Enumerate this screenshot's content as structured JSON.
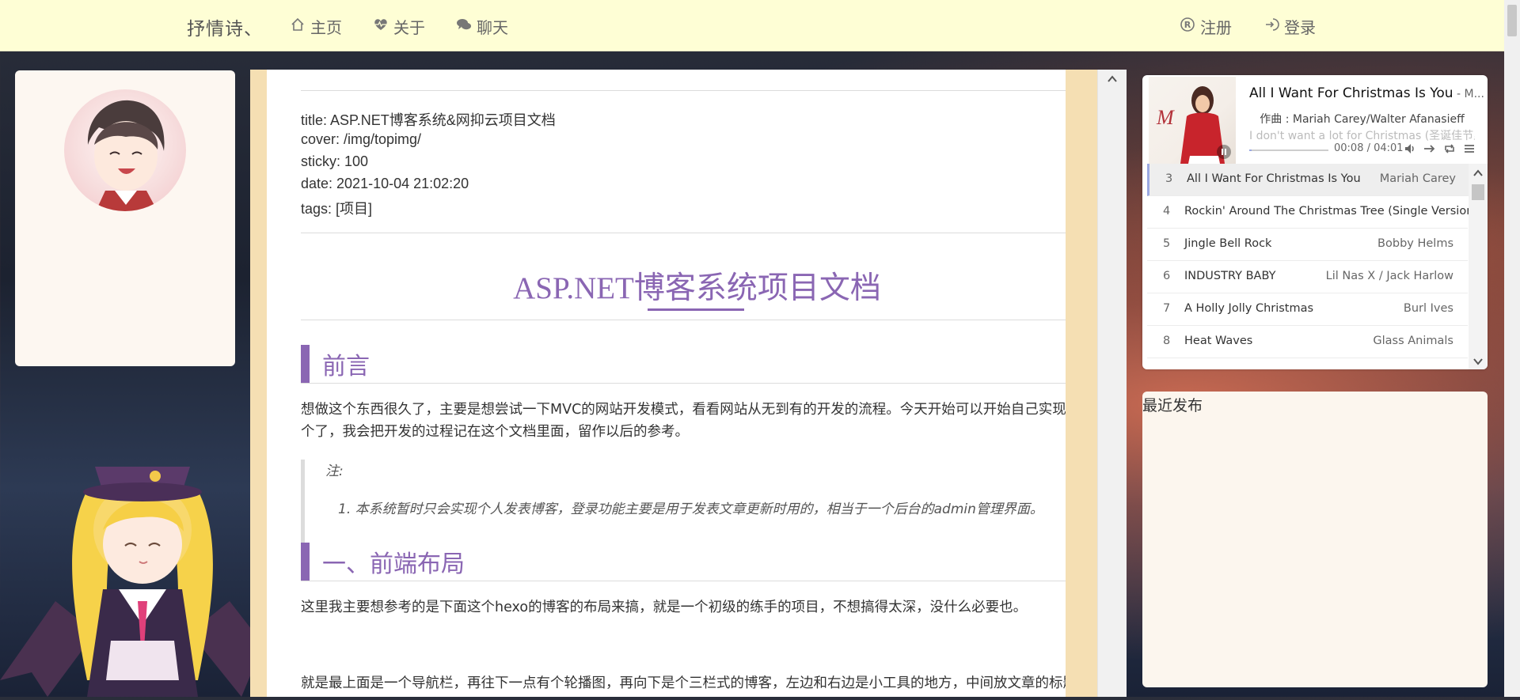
{
  "navbar": {
    "brand": "抒情诗、",
    "links": [
      {
        "label": "主页",
        "icon": "home-icon"
      },
      {
        "label": "关于",
        "icon": "heartbeat-icon"
      },
      {
        "label": "聊天",
        "icon": "chat-icon"
      }
    ],
    "auth": [
      {
        "label": "注册",
        "icon": "registered-icon"
      },
      {
        "label": "登录",
        "icon": "login-icon"
      }
    ]
  },
  "article": {
    "front_matter": [
      "title: ASP.NET博客系统&网抑云项目文档",
      "cover: /img/topimg/",
      "sticky: 100",
      "date: 2021-10-04 21:02:20",
      "tags: [项目]"
    ],
    "title": "ASP.NET博客系统项目文档",
    "sections": [
      {
        "heading": "前言"
      },
      {
        "heading": "一、前端布局"
      }
    ],
    "preface_text": "想做这个东西很久了，主要是想尝试一下MVC的网站开发模式，看看网站从无到有的开发的流程。今天开始可以开始自己实现一个了，我会把开发的过程记在这个文档里面，留作以后的参考。",
    "note_title": "注:",
    "note_item": "1. 本系统暂时只会实现个人发表博客，登录功能主要是用于发表文章更新时用的，相当于一个后台的admin管理界面。",
    "layout_text": "这里我主要想参考的是下面这个hexo的博客的布局来搞，就是一个初级的练手的项目，不想搞得太深，没什么必要也。",
    "layout_text2": "就是最上面是一个导航栏，再往下一点有个轮播图，再向下是个三栏式的博客，左边和右边是小工具的地方，中间放文章的标题与"
  },
  "player": {
    "title": "All I Want For Christmas Is You",
    "artist_suffix": " - M...",
    "composer": "作曲 : Mariah Carey/Walter Afanasieff",
    "lyric_next": "I don't want a lot for Christmas (圣诞佳节里",
    "time": "00:08 / 04:01",
    "progress": 0.033,
    "playlist": [
      {
        "num": "3",
        "name": "All I Want For Christmas Is You",
        "artist": "Mariah Carey",
        "active": true
      },
      {
        "num": "4",
        "name": "Rockin' Around The Christmas Tree (Single Version)",
        "artist": ""
      },
      {
        "num": "5",
        "name": "Jingle Bell Rock",
        "artist": "Bobby Helms"
      },
      {
        "num": "6",
        "name": "INDUSTRY BABY",
        "artist": "Lil Nas X / Jack Harlow"
      },
      {
        "num": "7",
        "name": "A Holly Jolly Christmas",
        "artist": "Burl Ives"
      },
      {
        "num": "8",
        "name": "Heat Waves",
        "artist": "Glass Animals"
      }
    ]
  },
  "recent": {
    "title": "最近发布"
  },
  "colors": {
    "navbar_bg": "#fefed5",
    "accent": "#8a66b3",
    "article_frame": "#f5dfb3"
  }
}
